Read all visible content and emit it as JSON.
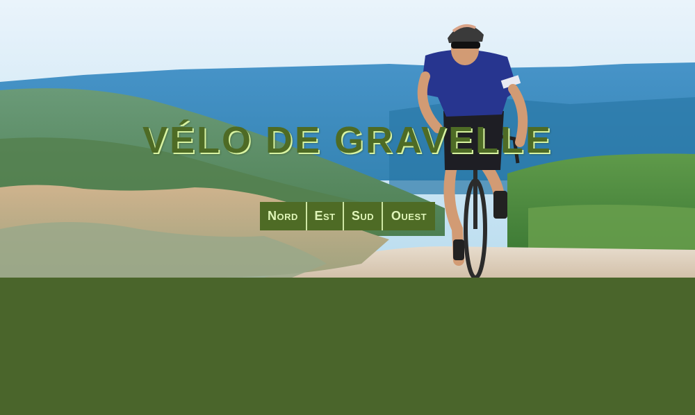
{
  "site": {
    "title": "VÉLO DE GRAVELLE"
  },
  "nav": {
    "items": [
      {
        "label": "Nord"
      },
      {
        "label": "Est"
      },
      {
        "label": "Sud"
      },
      {
        "label": "Ouest"
      }
    ]
  },
  "theme": {
    "brand_green": "#4e6b25",
    "page_background": "#4a652b",
    "title_highlight": "#d8f3a2"
  },
  "hero": {
    "icon": "cyclist-on-gravel-road-photo"
  }
}
